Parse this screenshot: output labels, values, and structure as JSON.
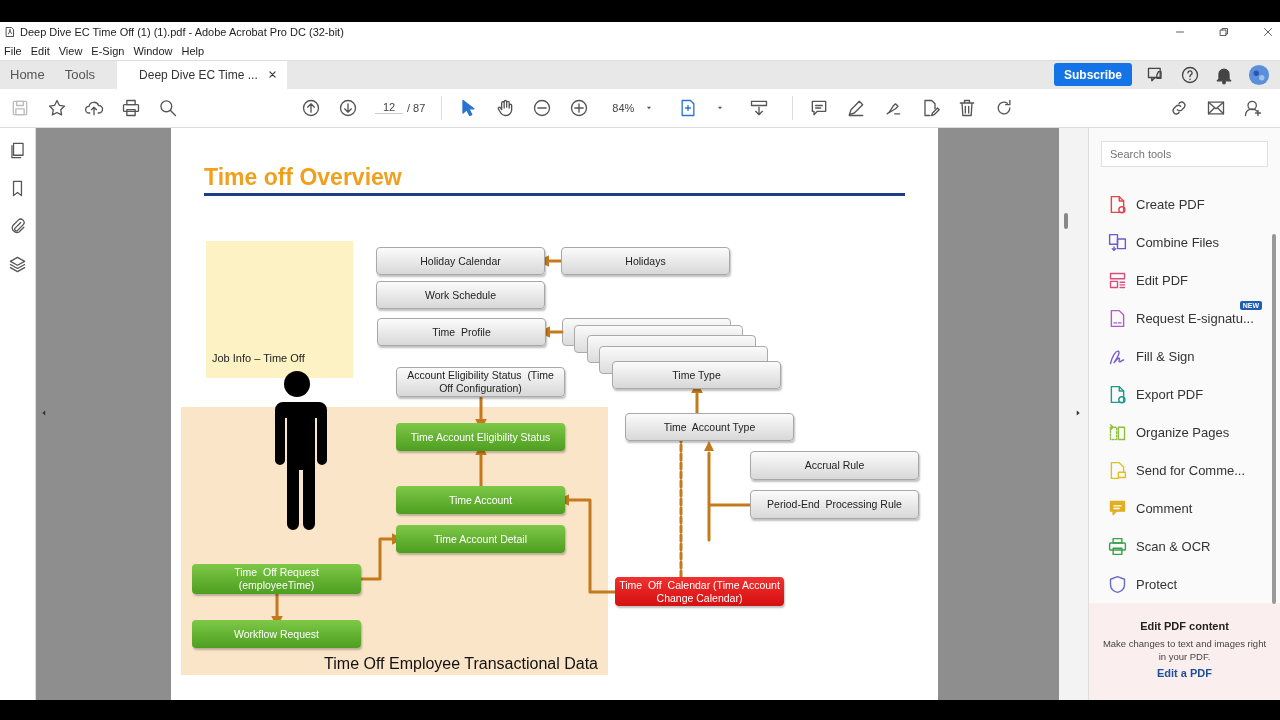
{
  "window": {
    "title": "Deep Dive EC Time Off  (1) (1).pdf - Adobe Acrobat Pro DC (32-bit)"
  },
  "menu": [
    "File",
    "Edit",
    "View",
    "E-Sign",
    "Window",
    "Help"
  ],
  "tabs": [
    {
      "label": "Home",
      "selected": false
    },
    {
      "label": "Tools",
      "selected": false
    },
    {
      "label": "Deep Dive EC Time ...",
      "selected": true
    }
  ],
  "subscribe": "Subscribe",
  "toolbar": {
    "page": "12",
    "total": "/ 87",
    "zoom": "84%"
  },
  "slide": {
    "title": "Time off Overview",
    "note": "Job Info – Time Off",
    "region_label": "Time Off Employee Transactional Data",
    "nodes": [
      {
        "label": "Holiday Calendar",
        "kind": "gray"
      },
      {
        "label": "Holidays",
        "kind": "gray"
      },
      {
        "label": "Work Schedule",
        "kind": "gray"
      },
      {
        "label": "Time  Profile",
        "kind": "gray"
      },
      {
        "label": "Account Eligibility Status  (Time Off Configuration)",
        "kind": "gray"
      },
      {
        "label": "Time Type",
        "kind": "gray"
      },
      {
        "label": "Time Account Eligibility Status",
        "kind": "green"
      },
      {
        "label": "Time  Account Type",
        "kind": "gray"
      },
      {
        "label": "Accrual Rule",
        "kind": "gray"
      },
      {
        "label": "Time Account",
        "kind": "green"
      },
      {
        "label": "Period-End  Processing Rule",
        "kind": "gray"
      },
      {
        "label": "Time Account Detail",
        "kind": "green"
      },
      {
        "label": "Time  Off Request (employeeTime)",
        "kind": "green"
      },
      {
        "label": "Time  Off  Calendar (Time Account Change Calendar)",
        "kind": "red"
      },
      {
        "label": "Workflow Request",
        "kind": "green"
      }
    ]
  },
  "tools_panel": {
    "search": {
      "placeholder": "Search tools"
    },
    "tools": [
      {
        "label": "Create PDF",
        "color": "#e0474c"
      },
      {
        "label": "Combine Files",
        "color": "#6a5acd"
      },
      {
        "label": "Edit PDF",
        "color": "#d94f7c"
      },
      {
        "label": "Request E-signatu...",
        "color": "#b05cc8",
        "badge": "NEW"
      },
      {
        "label": "Fill & Sign",
        "color": "#7b5cc8"
      },
      {
        "label": "Export PDF",
        "color": "#1f9a8a"
      },
      {
        "label": "Organize Pages",
        "color": "#8bbf3c"
      },
      {
        "label": "Send for Comme...",
        "color": "#e0c020"
      },
      {
        "label": "Comment",
        "color": "#e0b020"
      },
      {
        "label": "Scan & OCR",
        "color": "#3aa14a"
      },
      {
        "label": "Protect",
        "color": "#6a6ac8"
      }
    ],
    "promo": {
      "title": "Edit PDF content",
      "text": "Make changes to text and images right in your PDF.",
      "link": "Edit a PDF"
    }
  }
}
